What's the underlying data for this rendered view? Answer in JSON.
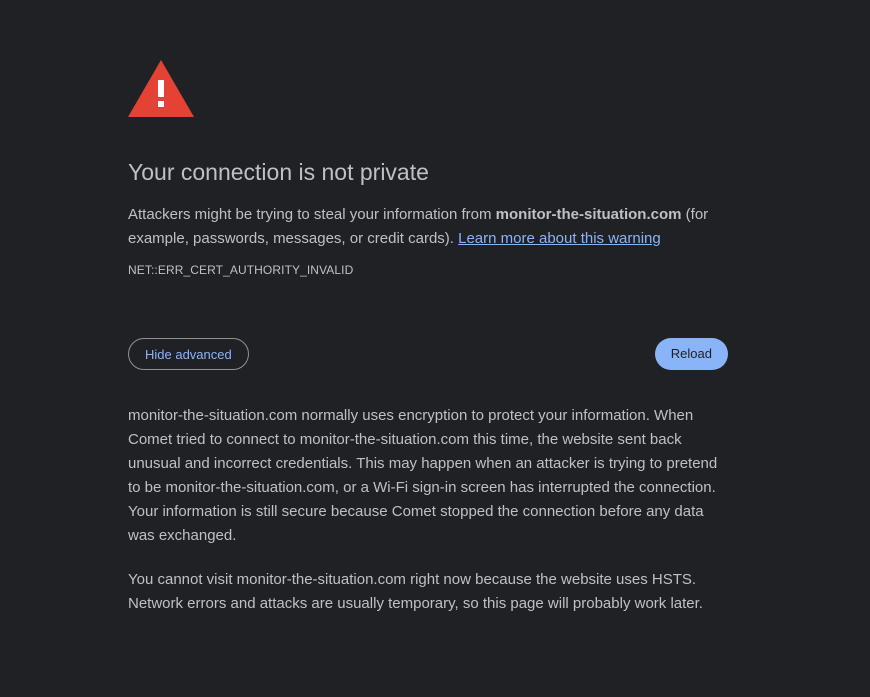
{
  "icon": {
    "name": "warning-triangle-icon",
    "color": "#e34234"
  },
  "heading": "Your connection is not private",
  "message": {
    "prefix": "Attackers might be trying to steal your information from ",
    "domain": "monitor-the-situation.com",
    "suffix": " (for example, passwords, messages, or credit cards). ",
    "link_text": "Learn more about this warning"
  },
  "error_code": "NET::ERR_CERT_AUTHORITY_INVALID",
  "buttons": {
    "hide_advanced": "Hide advanced",
    "reload": "Reload"
  },
  "details": {
    "paragraph1": "monitor-the-situation.com normally uses encryption to protect your information. When Comet tried to connect to monitor-the-situation.com this time, the website sent back unusual and incorrect credentials. This may happen when an attacker is trying to pretend to be monitor-the-situation.com, or a Wi-Fi sign-in screen has interrupted the connection. Your information is still secure because Comet stopped the connection before any data was exchanged.",
    "paragraph2": "You cannot visit monitor-the-situation.com right now because the website uses HSTS. Network errors and attacks are usually temporary, so this page will probably work later."
  },
  "colors": {
    "background": "#202124",
    "text": "#bdc1c6",
    "link": "#8ab4f8",
    "accent_red": "#e34234"
  }
}
